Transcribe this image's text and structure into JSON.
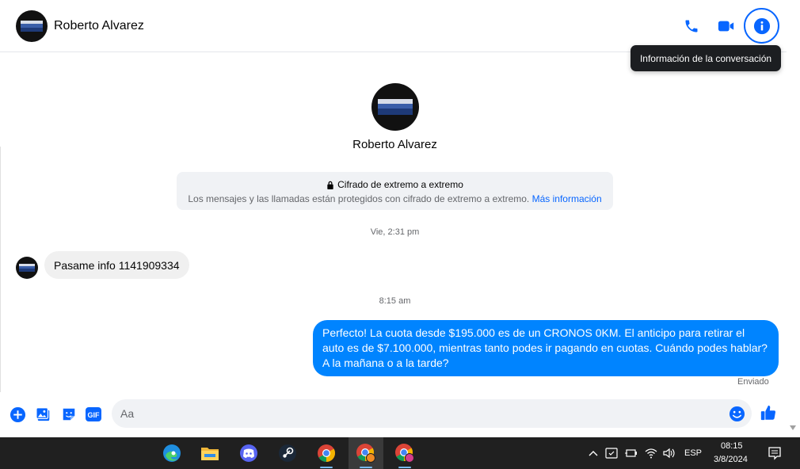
{
  "contact": {
    "name": "Roberto Alvarez"
  },
  "header": {
    "tooltip": "Información de la conversación"
  },
  "encryption": {
    "title": "Cifrado de extremo a extremo",
    "description": "Los mensajes y las llamadas están protegidos con cifrado de extremo a extremo.",
    "link": "Más información"
  },
  "messages": [
    {
      "timestamp": "Vie, 2:31 pm",
      "direction": "incoming",
      "text": "Pasame info 1141909334"
    },
    {
      "timestamp": "8:15 am",
      "direction": "outgoing",
      "text": "Perfecto! La cuota desde $195.000 es de un CRONOS 0KM. El anticipo para retirar el auto es de $7.100.000, mientras tanto podes ir pagando en cuotas. Cuándo podes hablar? A la mañana o a la tarde?",
      "status": "Enviado"
    }
  ],
  "composer": {
    "placeholder": "Aa",
    "icons": [
      "plus-icon",
      "image-icon",
      "sticker-icon",
      "gif-icon",
      "emoji-icon",
      "thumbs-up-icon"
    ],
    "gif_label": "GIF"
  },
  "taskbar": {
    "apps": [
      "edge-icon",
      "file-explorer-icon",
      "discord-icon",
      "steam-icon",
      "chrome-icon",
      "chrome-profile-icon",
      "chrome-profile-icon"
    ],
    "language": "ESP",
    "time": "08:15",
    "date": "3/8/2024"
  },
  "colors": {
    "accent": "#0866ff",
    "outgoing_bubble": "#0084ff",
    "incoming_bubble": "#f0f0f0",
    "taskbar": "#202020"
  }
}
